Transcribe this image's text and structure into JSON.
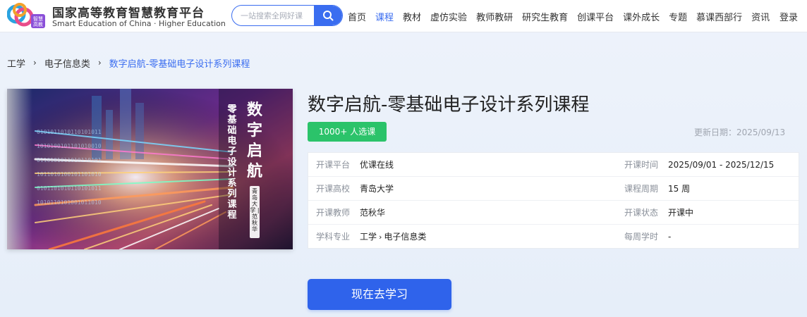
{
  "header": {
    "brand_cn": "国家高等教育智慧教育平台",
    "brand_en": "Smart Education of China · Higher Education",
    "logo_badge": "智慧高教",
    "search_placeholder": "一站搜索全网好课",
    "nav": [
      {
        "label": "首页",
        "active": false
      },
      {
        "label": "课程",
        "active": true
      },
      {
        "label": "教材",
        "active": false
      },
      {
        "label": "虚仿实验",
        "active": false
      },
      {
        "label": "教师教研",
        "active": false
      },
      {
        "label": "研究生教育",
        "active": false
      },
      {
        "label": "创课平台",
        "active": false
      },
      {
        "label": "课外成长",
        "active": false
      },
      {
        "label": "专题",
        "active": false
      },
      {
        "label": "慕课西部行",
        "active": false
      },
      {
        "label": "资讯",
        "active": false
      }
    ],
    "login_label": "登录",
    "accent_color": "#3a6df0"
  },
  "breadcrumb": [
    "工学",
    "电子信息类",
    "数字启航-零基础电子设计系列课程"
  ],
  "cover": {
    "title": "数字启航",
    "subtitle": "零基础电子设计系列课程",
    "school_teacher": "青岛大学 | 范秋华"
  },
  "course": {
    "title": "数字启航-零基础电子设计系列课程",
    "enrolled_badge": "1000+ 人选课",
    "update_label": "更新日期：2025/09/13",
    "info": {
      "platform_label": "开课平台",
      "platform": "优课在线",
      "time_label": "开课时间",
      "time": "2025/09/01 - 2025/12/15",
      "school_label": "开课高校",
      "school": "青岛大学",
      "period_label": "课程周期",
      "period": "15 周",
      "teacher_label": "开课教师",
      "teacher": "范秋华",
      "status_label": "开课状态",
      "status": "开课中",
      "subject_label": "学科专业",
      "subject_main": "工学",
      "subject_sub": "电子信息类",
      "hours_label": "每周学时",
      "hours": "-"
    },
    "cta_label": "现在去学习",
    "badge_color": "#2bc36a",
    "cta_color": "#2f63eb"
  }
}
